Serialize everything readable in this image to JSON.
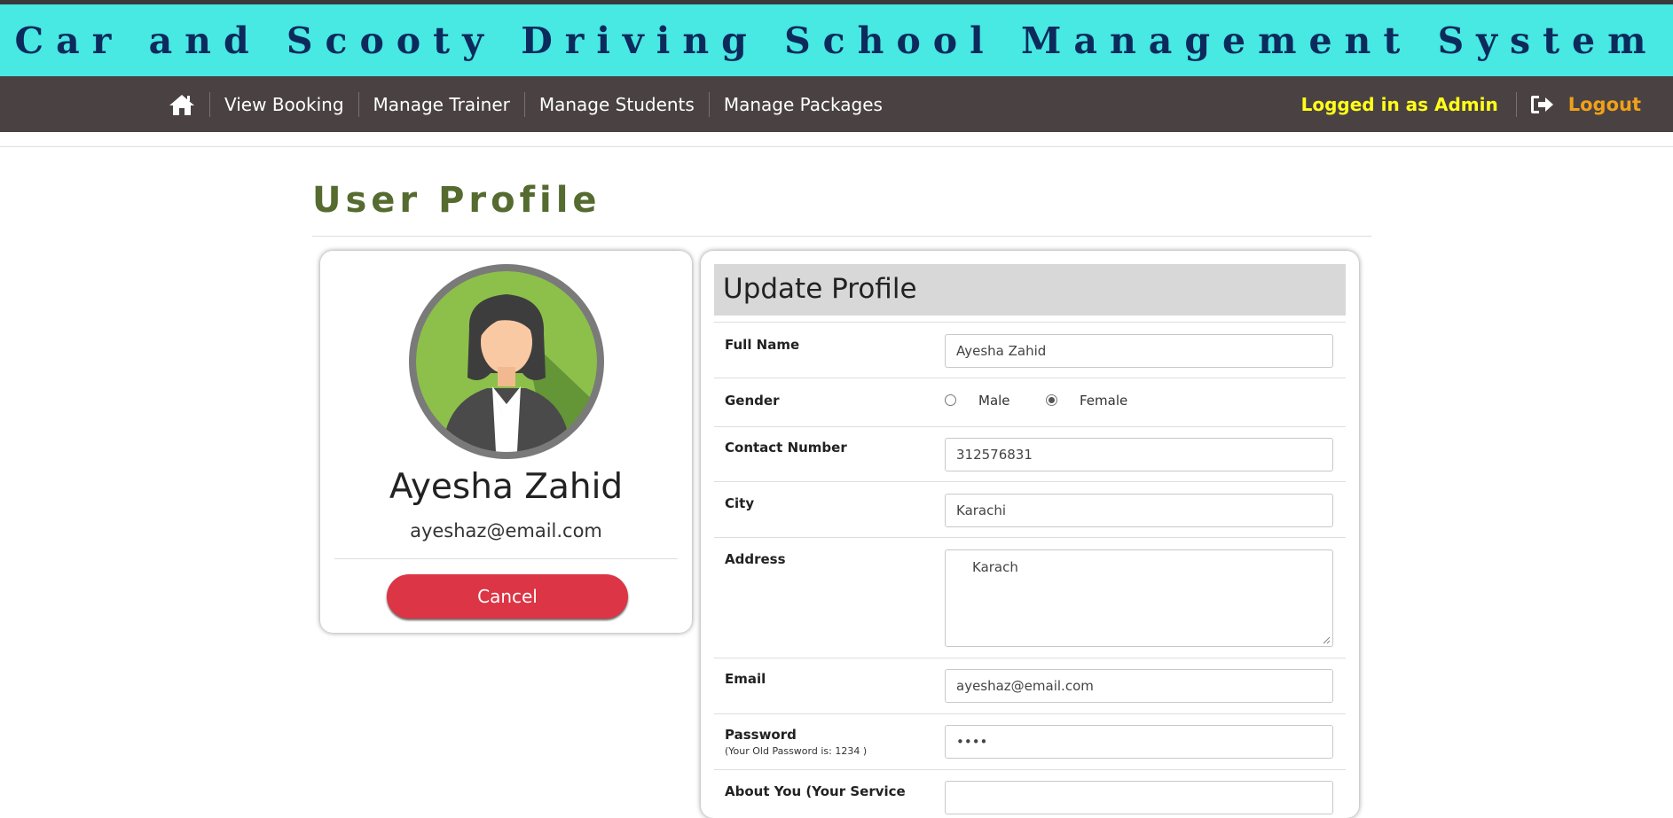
{
  "banner": {
    "title": "Car and Scooty Driving School Management System"
  },
  "nav": {
    "home_icon": "home-icon",
    "links": [
      "View Booking",
      "Manage Trainer",
      "Manage Students",
      "Manage Packages"
    ],
    "logged_in": "Logged in as Admin",
    "logout_icon": "sign-out-icon",
    "logout": "Logout"
  },
  "page": {
    "title": "User Profile"
  },
  "profile_card": {
    "name": "Ayesha Zahid",
    "email": "ayeshaz@email.com",
    "cancel": "Cancel"
  },
  "form": {
    "heading": "Update Profile",
    "full_name": {
      "label": "Full Name",
      "value": "Ayesha Zahid"
    },
    "gender": {
      "label": "Gender",
      "options": [
        "Male",
        "Female"
      ],
      "selected": "Female"
    },
    "contact": {
      "label": "Contact Number",
      "value": "312576831"
    },
    "city": {
      "label": "City",
      "value": "Karachi"
    },
    "address": {
      "label": "Address",
      "value": "Karach"
    },
    "email": {
      "label": "Email",
      "value": "ayeshaz@email.com"
    },
    "password": {
      "label": "Password",
      "hint": "(Your Old Password is: 1234 )",
      "value": "••••"
    },
    "about": {
      "label": "About You (Your Service"
    }
  },
  "colors": {
    "banner_bg": "#48e8e3",
    "banner_text": "#0d2a5c",
    "nav_bg": "#4a4242",
    "admin_text": "#ffff1a",
    "logout_text": "#f0a11a",
    "title_text": "#556b2f",
    "cancel_bg": "#dc3545"
  }
}
